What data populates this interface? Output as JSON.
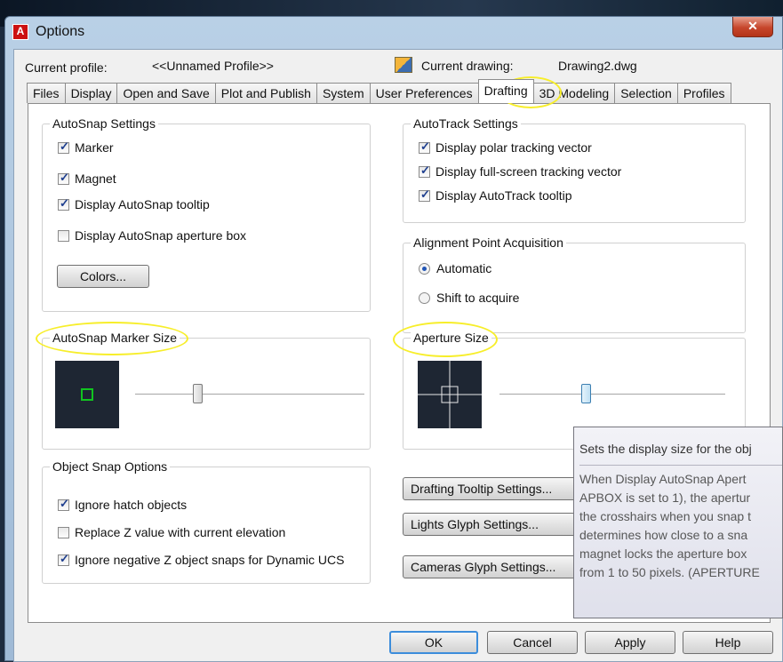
{
  "window": {
    "title": "Options",
    "close_label": "✕"
  },
  "header": {
    "current_profile_label": "Current profile:",
    "current_profile_value": "<<Unnamed Profile>>",
    "current_drawing_label": "Current drawing:",
    "current_drawing_value": "Drawing2.dwg"
  },
  "tabs": [
    "Files",
    "Display",
    "Open and Save",
    "Plot and Publish",
    "System",
    "User Preferences",
    "Drafting",
    "3D Modeling",
    "Selection",
    "Profiles"
  ],
  "active_tab": "Drafting",
  "autosnap_settings": {
    "title": "AutoSnap Settings",
    "marker": {
      "label": "Marker",
      "checked": true
    },
    "magnet": {
      "label": "Magnet",
      "checked": true
    },
    "tooltip": {
      "label": "Display AutoSnap tooltip",
      "checked": true
    },
    "aperture_box": {
      "label": "Display AutoSnap aperture box",
      "checked": false
    },
    "colors_button": "Colors..."
  },
  "autotrack_settings": {
    "title": "AutoTrack Settings",
    "polar": {
      "label": "Display polar tracking vector",
      "checked": true
    },
    "fullscreen": {
      "label": "Display full-screen tracking vector",
      "checked": true
    },
    "tooltip": {
      "label": "Display AutoTrack tooltip",
      "checked": true
    }
  },
  "alignment": {
    "title": "Alignment Point Acquisition",
    "automatic": {
      "label": "Automatic",
      "selected": true
    },
    "shift": {
      "label": "Shift to acquire",
      "selected": false
    }
  },
  "marker_size": {
    "title": "AutoSnap Marker Size",
    "slider_fraction": 0.27
  },
  "aperture_size": {
    "title": "Aperture Size",
    "slider_fraction": 0.38
  },
  "object_snap_options": {
    "title": "Object Snap Options",
    "ignore_hatch": {
      "label": "Ignore hatch objects",
      "checked": true
    },
    "replace_z": {
      "label": "Replace Z value with current elevation",
      "checked": false
    },
    "ignore_negative_z": {
      "label": "Ignore negative Z object snaps for Dynamic UCS",
      "checked": true
    }
  },
  "side_buttons": {
    "drafting_tooltip": "Drafting Tooltip Settings...",
    "lights_glyph": "Lights Glyph Settings...",
    "cameras_glyph": "Cameras Glyph Settings..."
  },
  "tooltip": {
    "title": "Sets the display size for the obj",
    "lines": [
      "When Display AutoSnap Apert",
      "APBOX is set to 1), the apertur",
      "the crosshairs when you snap t",
      "determines how close to a sna",
      "magnet locks the aperture box",
      "from 1 to 50 pixels. (APERTURE"
    ]
  },
  "footer_buttons": {
    "ok": "OK",
    "cancel": "Cancel",
    "apply": "Apply",
    "help": "Help"
  },
  "icons": {
    "app": "autocad-logo-icon",
    "drawing": "drawing-file-icon",
    "close": "close-icon"
  },
  "colors": {
    "highlight": "#f7ee2a",
    "marker_green": "#11c420",
    "preview_bg": "#1e2633"
  }
}
